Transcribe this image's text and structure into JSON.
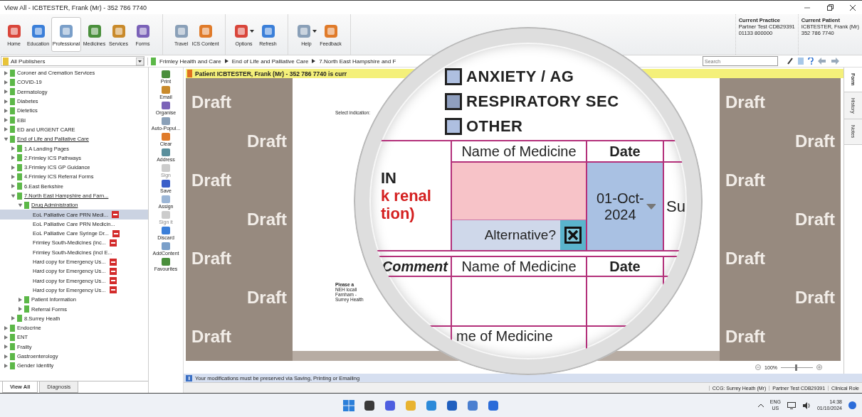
{
  "window": {
    "title": "View All  -  ICBTESTER, Frank (Mr) - 352 786 7740"
  },
  "ribbon": {
    "groups": [
      {
        "buttons": [
          {
            "label": "Home",
            "selected": false,
            "dropdown": false
          },
          {
            "label": "Education",
            "selected": false,
            "dropdown": false
          },
          {
            "label": "Professional",
            "selected": true,
            "dropdown": false
          },
          {
            "label": "Medicines",
            "selected": false,
            "dropdown": false
          },
          {
            "label": "Services",
            "selected": false,
            "dropdown": false
          },
          {
            "label": "Forms",
            "selected": false,
            "dropdown": false
          }
        ]
      },
      {
        "buttons": [
          {
            "label": "Travel",
            "selected": false,
            "dropdown": false
          },
          {
            "label": "ICS Content",
            "selected": false,
            "dropdown": false
          }
        ]
      },
      {
        "buttons": [
          {
            "label": "Options",
            "selected": false,
            "dropdown": true
          },
          {
            "label": "Refresh",
            "selected": false,
            "dropdown": false
          }
        ]
      },
      {
        "buttons": [
          {
            "label": "Help",
            "selected": false,
            "dropdown": true
          },
          {
            "label": "Feedback",
            "selected": false,
            "dropdown": false
          }
        ]
      }
    ],
    "practice": {
      "heading": "Current Practice",
      "lines": [
        "Partner Test CDB29391",
        "01133 800000"
      ]
    },
    "patient": {
      "heading": "Current Patient",
      "lines": [
        "ICBTESTER, Frank (Mr)",
        "352 786 7740"
      ]
    }
  },
  "publisher_select": {
    "value": "All Publishers"
  },
  "breadcrumb": [
    "Frimley Health and Care",
    "End of Life and Palliative Care",
    "7.North East Hampshire and F"
  ],
  "search": {
    "placeholder": "Search"
  },
  "sidebar": {
    "items": [
      {
        "label": "Coroner and Cremation Services",
        "kind": "folder",
        "expanded": false
      },
      {
        "label": "COVID-19",
        "kind": "folder",
        "expanded": false
      },
      {
        "label": "Dermatology",
        "kind": "folder",
        "expanded": false
      },
      {
        "label": "Diabetes",
        "kind": "folder",
        "expanded": false
      },
      {
        "label": "Dietetics",
        "kind": "folder",
        "expanded": false
      },
      {
        "label": "EBI",
        "kind": "folder",
        "expanded": false
      },
      {
        "label": "ED and URGENT CARE",
        "kind": "folder",
        "expanded": false
      },
      {
        "label": "End of Life and Palliative Care",
        "kind": "folder",
        "expanded": true,
        "children": [
          {
            "label": "1.A Landing Pages",
            "kind": "folder",
            "expanded": false
          },
          {
            "label": "2.Frimley ICS Pathways",
            "kind": "folder",
            "expanded": false
          },
          {
            "label": "3.Frimley ICS GP Guidance",
            "kind": "folder",
            "expanded": false
          },
          {
            "label": "4.Frimley ICS Referral Forms",
            "kind": "folder",
            "expanded": false
          },
          {
            "label": "6.East Berkshire",
            "kind": "folder",
            "expanded": false
          },
          {
            "label": "7.North East Hampshire and Farn...",
            "kind": "folder",
            "expanded": true,
            "children": [
              {
                "label": "Drug Administration",
                "kind": "folder",
                "expanded": true,
                "children": [
                  {
                    "label": "EoL Palliative Care PRN Medi...",
                    "kind": "document",
                    "flagged": true,
                    "selected": true
                  },
                  {
                    "label": "EoL Palliative Care PRN Medicin...",
                    "kind": "document",
                    "flagged": false,
                    "selected": false
                  },
                  {
                    "label": "EoL Palliative Care Syringe Dr...",
                    "kind": "document",
                    "flagged": true,
                    "selected": false
                  },
                  {
                    "label": "Frimley South-Medicines (inc...",
                    "kind": "document",
                    "flagged": true,
                    "selected": false
                  },
                  {
                    "label": "Frimley South-Medicines (incl E...",
                    "kind": "document",
                    "flagged": false,
                    "selected": false
                  },
                  {
                    "label": "Hard copy for Emergency Us...",
                    "kind": "document",
                    "flagged": true,
                    "selected": false
                  },
                  {
                    "label": "Hard copy for Emergency Us...",
                    "kind": "document",
                    "flagged": true,
                    "selected": false
                  },
                  {
                    "label": "Hard copy for Emergency Us...",
                    "kind": "document",
                    "flagged": true,
                    "selected": false
                  },
                  {
                    "label": "Hard copy for Emergency Us...",
                    "kind": "document",
                    "flagged": true,
                    "selected": false
                  }
                ]
              },
              {
                "label": "Patient Information",
                "kind": "folder",
                "expanded": false
              },
              {
                "label": "Referral Forms",
                "kind": "folder",
                "expanded": false
              }
            ]
          },
          {
            "label": "8.Surrey Heath",
            "kind": "folder",
            "expanded": false
          }
        ]
      },
      {
        "label": "Endocrine",
        "kind": "folder",
        "expanded": false
      },
      {
        "label": "ENT",
        "kind": "folder",
        "expanded": false
      },
      {
        "label": "Frailty",
        "kind": "folder",
        "expanded": false
      },
      {
        "label": "Gastroenterology",
        "kind": "folder",
        "expanded": false
      },
      {
        "label": "Gender Identity",
        "kind": "folder",
        "expanded": false
      }
    ]
  },
  "sidebar_tabs": [
    {
      "label": "View All",
      "selected": true
    },
    {
      "label": "Diagnosis",
      "selected": false
    }
  ],
  "tools": [
    {
      "label": "Print",
      "disabled": false
    },
    {
      "label": "Email",
      "disabled": false
    },
    {
      "label": "Organise",
      "disabled": false
    },
    {
      "label": "Auto-Popul...",
      "disabled": false
    },
    {
      "label": "Clear",
      "disabled": false
    },
    {
      "label": "Address",
      "disabled": false
    },
    {
      "label": "Sign",
      "disabled": true
    },
    {
      "label": "Save",
      "disabled": false
    },
    {
      "label": "Assign",
      "disabled": false
    },
    {
      "label": "Sign it",
      "disabled": true
    },
    {
      "label": "Discard",
      "disabled": false
    },
    {
      "label": "AddContent",
      "disabled": false
    },
    {
      "label": "Favourites",
      "disabled": false
    }
  ],
  "banner": {
    "text": "Patient ICBTESTER, Frank (Mr) - 352 786 7740 is curr"
  },
  "document": {
    "watermarks_left": [
      "Draft",
      "Draft",
      "Draft",
      "Draft",
      "Draft",
      "Draft",
      "Draft"
    ],
    "watermarks_right": [
      "Draft",
      "Draft",
      "Draft",
      "Draft",
      "Draft",
      "Draft",
      "Draft"
    ],
    "indication_label": "Select indication:",
    "notes": [
      "Please a",
      "NEH locali",
      "Farnham -",
      "Surrey Health"
    ]
  },
  "magnifier": {
    "options": [
      {
        "label": "ANXIETY / AG",
        "checked": false
      },
      {
        "label": "RESPIRATORY SEC",
        "checked": false
      },
      {
        "label": "OTHER",
        "checked": false
      }
    ],
    "row_title": "IN",
    "row_warning": [
      "k renal",
      "tion)"
    ],
    "headers": [
      "Name of Medicine",
      "Date"
    ],
    "date": "01-Oct-2024",
    "alternative": {
      "label": "Alternative?",
      "checked": true
    },
    "side_text": "Su",
    "comment_header": "Comment",
    "second_headers": [
      "Name of Medicine",
      "Date"
    ],
    "footer_text": "me of Medicine"
  },
  "right_tabs": [
    {
      "label": "Form",
      "selected": true
    },
    {
      "label": "History",
      "selected": false
    },
    {
      "label": "Notes",
      "selected": false
    }
  ],
  "zoom": {
    "reading": "100%",
    "level": 0.45
  },
  "info_message": "Your modifications must be preserved via Saving, Printing or Emailing",
  "status": [
    "CCG: Surrey Heath (Mr)",
    "Partner Test CDB29391",
    "Clinical Role"
  ],
  "taskbar": {
    "language": "ENG",
    "region": "US",
    "time": "14:38",
    "date": "01/10/2024"
  }
}
